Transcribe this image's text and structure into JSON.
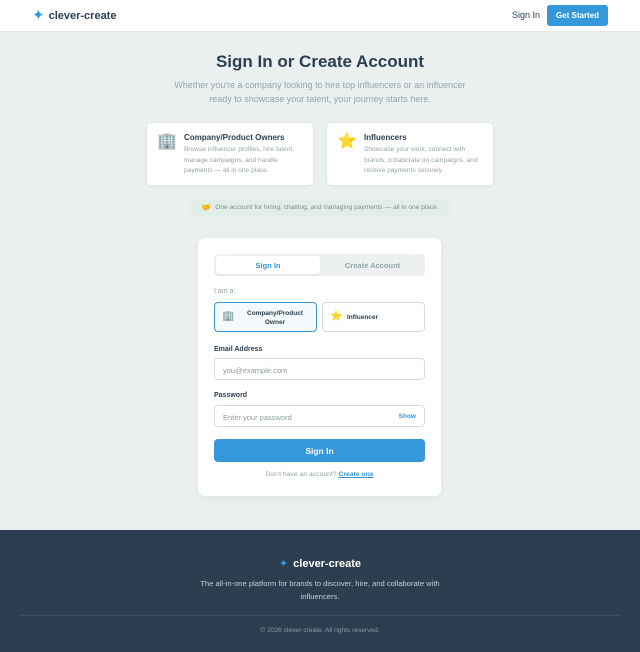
{
  "nav": {
    "brand": "clever-create",
    "brand_icon": "sparkle-icon",
    "signin_label": "Sign In",
    "cta_label": "Get Started"
  },
  "hero": {
    "title": "Sign In or Create Account",
    "subtitle": "Whether you're a company looking to hire top influencers or an influencer ready to showcase your talent, your journey starts here."
  },
  "roles": [
    {
      "icon": "building-icon",
      "glyph": "🏢",
      "title": "Company/Product Owners",
      "desc": "Browse influencer profiles, hire talent, manage campaigns, and handle payments — all in one place."
    },
    {
      "icon": "star-icon",
      "glyph": "⭐",
      "title": "Influencers",
      "desc": "Showcase your work, connect with brands, collaborate on campaigns, and receive payments securely."
    }
  ],
  "info_pill": {
    "icon": "handshake-icon",
    "glyph": "🤝",
    "text": "One account for hiring, chatting, and managing payments — all in one place."
  },
  "auth": {
    "tabs": [
      {
        "label": "Sign In",
        "active": true
      },
      {
        "label": "Create Account",
        "active": false
      }
    ],
    "iam_label": "I am a:",
    "options": [
      {
        "label": "Company/Product Owner",
        "glyph": "🏢",
        "selected": true
      },
      {
        "label": "Influencer",
        "glyph": "⭐",
        "selected": false
      }
    ],
    "email": {
      "label": "Email Address",
      "placeholder": "you@example.com",
      "value": ""
    },
    "password": {
      "label": "Password",
      "placeholder": "Enter your password",
      "value": "",
      "toggle_label": "Show"
    },
    "submit_label": "Sign In",
    "switch_text": "Don't have an account?",
    "switch_link": "Create one"
  },
  "footer": {
    "brand": "clever-create",
    "tagline": "The all-in-one platform for brands to discover, hire, and collaborate with influencers.",
    "copyright": "© 2026 clever-create. All rights reserved."
  },
  "colors": {
    "accent": "#3498db",
    "text": "#2c3e50",
    "muted": "#95a5a6",
    "background": "#eaf0f0",
    "footer_bg": "#2c3e50"
  }
}
